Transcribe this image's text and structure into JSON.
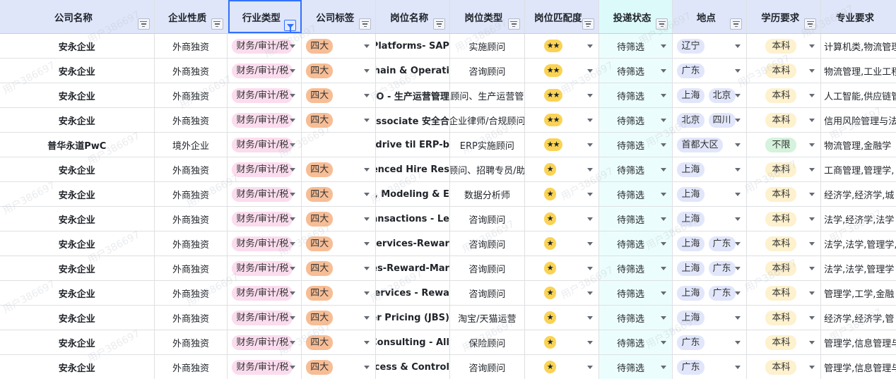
{
  "watermark": "用户386697",
  "columns": [
    "公司名称",
    "企业性质",
    "行业类型",
    "公司标签",
    "岗位名称",
    "岗位类型",
    "岗位匹配度",
    "投递状态",
    "地点",
    "学历要求",
    "专业要求"
  ],
  "rows": [
    {
      "company": "安永企业",
      "nature": "外商独资",
      "industry": "财务/审计/税",
      "tag": "四大",
      "job": "- Platforms- SAP",
      "jobtype": "实施顾问",
      "match": "★★",
      "status": "待筛选",
      "loc": [
        "辽宁"
      ],
      "edu": "本科",
      "major": "计算机类,物流管理"
    },
    {
      "company": "安永企业",
      "nature": "外商独资",
      "industry": "财务/审计/税",
      "tag": "四大",
      "job": "y Chain & Operati",
      "jobtype": "咨询顾问",
      "match": "★★",
      "status": "待筛选",
      "loc": [
        "广东"
      ],
      "edu": "本科",
      "major": "物流管理,工业工程"
    },
    {
      "company": "安永企业",
      "nature": "外商独资",
      "industry": "财务/审计/税",
      "tag": "四大",
      "job": "&O - 生产运营管理",
      "jobtype": "顾问、生产运营管",
      "match": "★★",
      "status": "待筛选",
      "loc": [
        "上海",
        "北京"
      ],
      "edu": "本科",
      "major": "人工智能,供应链管"
    },
    {
      "company": "安永企业",
      "nature": "外商独资",
      "industry": "财务/审计/税",
      "tag": "四大",
      "job": "Associate 安全合",
      "jobtype": "企业律师/合规顾问",
      "match": "★★",
      "status": "待筛选",
      "loc": [
        "北京",
        "四川"
      ],
      "edu": "本科",
      "major": "信用风险管理与法"
    },
    {
      "company": "普华永道PwC",
      "nature": "境外企业",
      "industry": "财务/审计/税",
      "tag": "",
      "job": "t drive til ERP-b",
      "jobtype": "ERP实施顾问",
      "match": "★★",
      "status": "待筛选",
      "loc": [
        "首都大区"
      ],
      "edu": "不限",
      "major": "物流管理,金融学"
    },
    {
      "company": "安永企业",
      "nature": "外商独资",
      "industry": "财务/审计/税",
      "tag": "四大",
      "job": "erienced Hire Res",
      "jobtype": "顾问、招聘专员/助",
      "match": "★",
      "status": "待筛选",
      "loc": [
        "上海"
      ],
      "edu": "本科",
      "major": "工商管理,管理学,"
    },
    {
      "company": "安永企业",
      "nature": "外商独资",
      "industry": "财务/审计/税",
      "tag": "四大",
      "job": "on, Modeling & E",
      "jobtype": "数据分析师",
      "match": "★",
      "status": "待筛选",
      "loc": [
        "上海"
      ],
      "edu": "本科",
      "major": "经济学,经济学,城"
    },
    {
      "company": "安永企业",
      "nature": "外商独资",
      "industry": "财务/审计/税",
      "tag": "四大",
      "job": "Transactions - Le",
      "jobtype": "咨询顾问",
      "match": "★",
      "status": "待筛选",
      "loc": [
        "上海"
      ],
      "edu": "本科",
      "major": "法学,经济学,法学"
    },
    {
      "company": "安永企业",
      "nature": "外商独资",
      "industry": "财务/审计/税",
      "tag": "四大",
      "job": "y Services-Rewar",
      "jobtype": "咨询顾问",
      "match": "★",
      "status": "待筛选",
      "loc": [
        "上海",
        "广东"
      ],
      "edu": "本科",
      "major": "法学,法学,管理学,"
    },
    {
      "company": "安永企业",
      "nature": "外商独资",
      "industry": "财务/审计/税",
      "tag": "四大",
      "job": "ces-Reward-Mar",
      "jobtype": "咨询顾问",
      "match": "★",
      "status": "待筛选",
      "loc": [
        "上海",
        "广东"
      ],
      "edu": "本科",
      "major": "法学,法学,管理学"
    },
    {
      "company": "安永企业",
      "nature": "外商独资",
      "industry": "财务/审计/税",
      "tag": "四大",
      "job": "Services - Rewa",
      "jobtype": "咨询顾问",
      "match": "★",
      "status": "待筛选",
      "loc": [
        "上海",
        "广东"
      ],
      "edu": "本科",
      "major": "管理学,工学,金融"
    },
    {
      "company": "安永企业",
      "nature": "外商独资",
      "industry": "财务/审计/税",
      "tag": "四大",
      "job": "fer Pricing (JBS)",
      "jobtype": "淘宝/天猫运营",
      "match": "★",
      "status": "待筛选",
      "loc": [
        "上海"
      ],
      "edu": "本科",
      "major": "经济学,经济学,管"
    },
    {
      "company": "安永企业",
      "nature": "外商独资",
      "industry": "财务/审计/税",
      "tag": "四大",
      "job": "Consulting - All",
      "jobtype": "保险顾问",
      "match": "★",
      "status": "待筛选",
      "loc": [
        "广东"
      ],
      "edu": "本科",
      "major": "管理学,信息管理与"
    },
    {
      "company": "安永企业",
      "nature": "外商独资",
      "industry": "财务/审计/税",
      "tag": "四大",
      "job": "rocess & Control",
      "jobtype": "咨询顾问",
      "match": "★",
      "status": "待筛选",
      "loc": [
        "广东"
      ],
      "edu": "本科",
      "major": "管理学,信息管理与"
    }
  ]
}
